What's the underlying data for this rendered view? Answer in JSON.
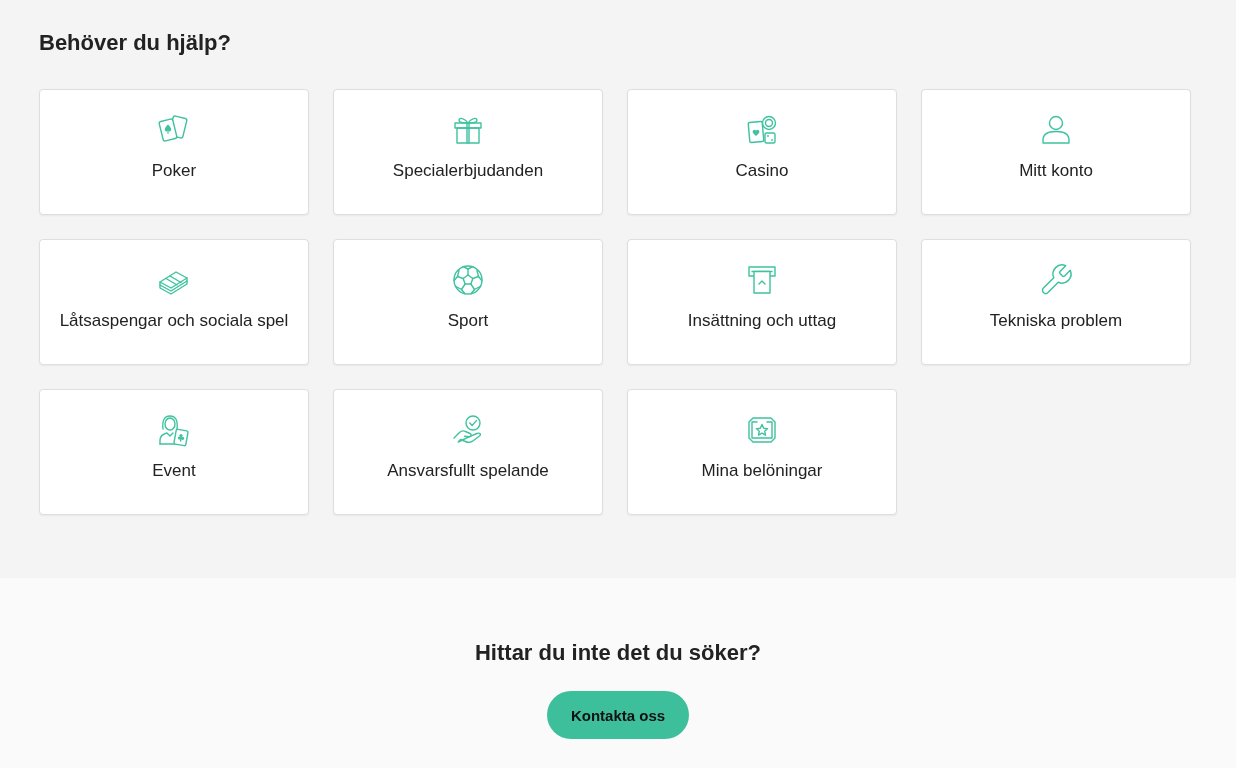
{
  "heading": "Behöver du hjälp?",
  "categories": [
    {
      "label": "Poker"
    },
    {
      "label": "Specialerbjudanden"
    },
    {
      "label": "Casino"
    },
    {
      "label": "Mitt konto"
    },
    {
      "label": "Låtsaspengar och sociala spel"
    },
    {
      "label": "Sport"
    },
    {
      "label": "Insättning och uttag"
    },
    {
      "label": "Tekniska problem"
    },
    {
      "label": "Event"
    },
    {
      "label": "Ansvarsfullt spelande"
    },
    {
      "label": "Mina belöningar"
    }
  ],
  "contact": {
    "title": "Hittar du inte det du söker?",
    "button": "Kontakta oss"
  }
}
